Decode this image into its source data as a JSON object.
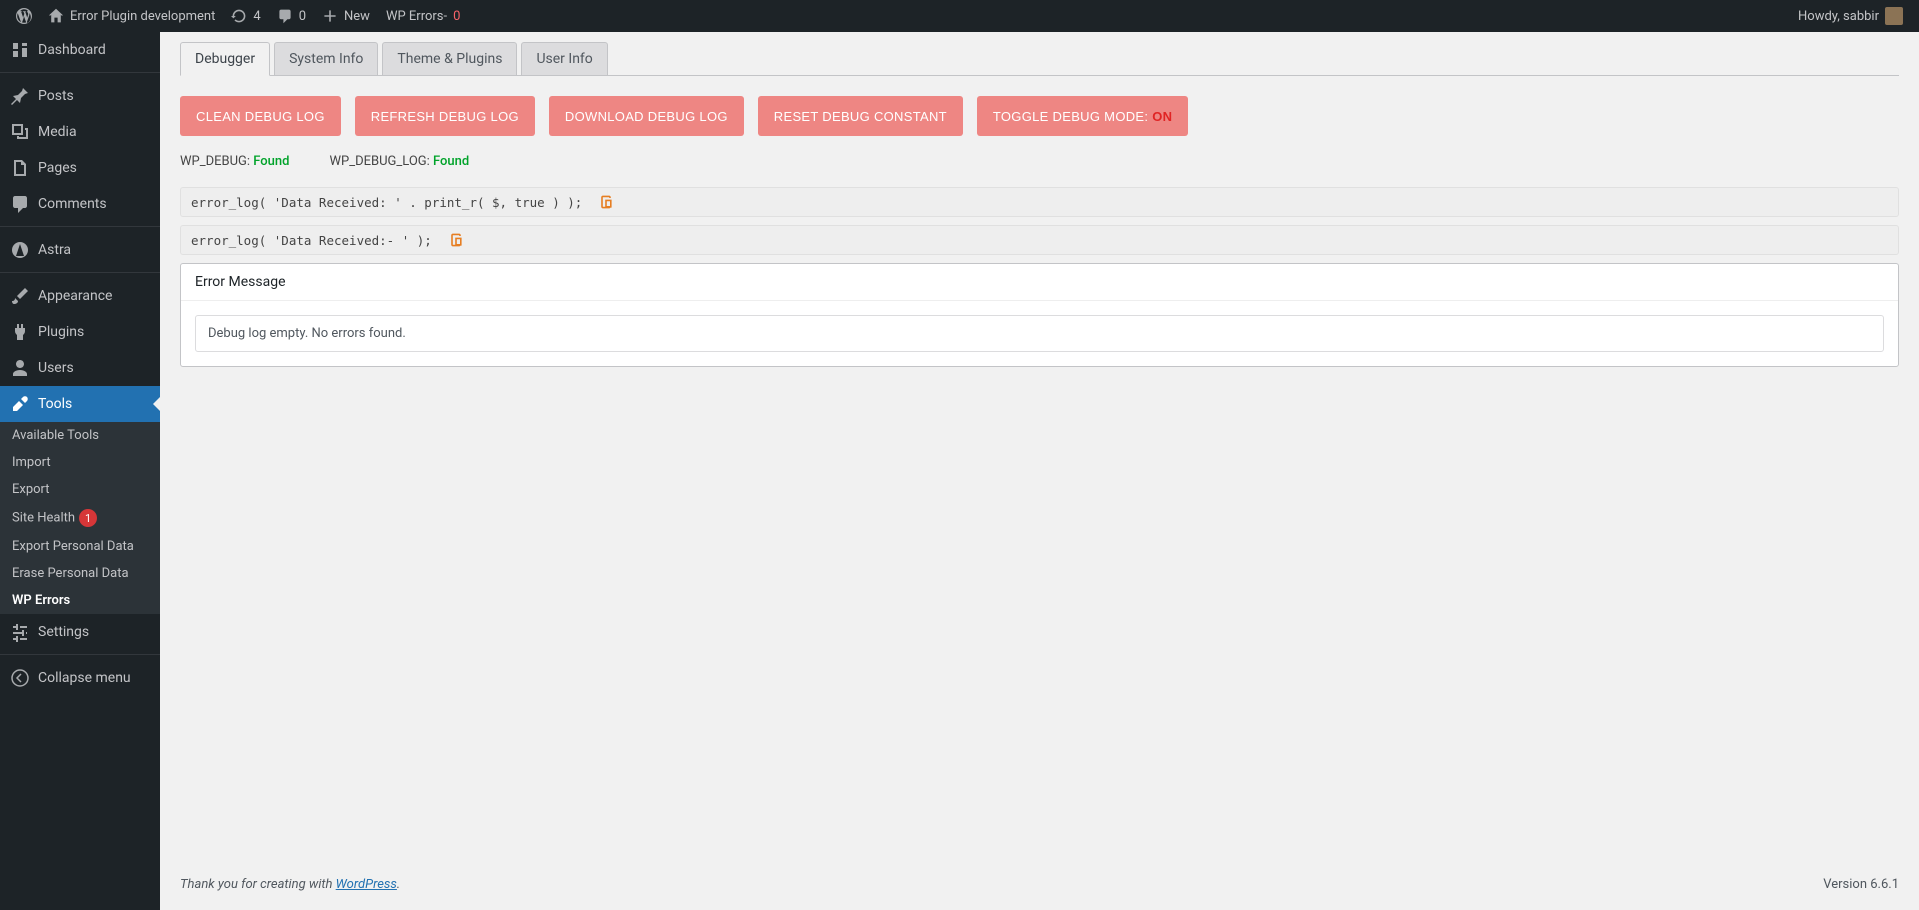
{
  "adminbar": {
    "site_name": "Error Plugin development",
    "updates_count": "4",
    "comments_count": "0",
    "new_label": "New",
    "wp_errors_label": "WP Errors-",
    "wp_errors_count": "0",
    "greeting": "Howdy, sabbir"
  },
  "sidebar": {
    "dashboard": "Dashboard",
    "posts": "Posts",
    "media": "Media",
    "pages": "Pages",
    "comments": "Comments",
    "astra": "Astra",
    "appearance": "Appearance",
    "plugins": "Plugins",
    "users": "Users",
    "tools": "Tools",
    "settings": "Settings",
    "collapse": "Collapse menu",
    "submenu": {
      "available_tools": "Available Tools",
      "import": "Import",
      "export": "Export",
      "site_health": "Site Health",
      "site_health_count": "1",
      "export_personal": "Export Personal Data",
      "erase_personal": "Erase Personal Data",
      "wp_errors": "WP Errors"
    }
  },
  "tabs": {
    "debugger": "Debugger",
    "system_info": "System Info",
    "theme_plugins": "Theme & Plugins",
    "user_info": "User Info"
  },
  "buttons": {
    "clean": "CLEAN DEBUG LOG",
    "refresh": "REFRESH DEBUG LOG",
    "download": "DOWNLOAD DEBUG LOG",
    "reset": "RESET DEBUG CONSTANT",
    "toggle_prefix": "TOGGLE DEBUG MODE: ",
    "toggle_state": "ON"
  },
  "status": {
    "wp_debug_label": "WP_DEBUG: ",
    "wp_debug_val": "Found",
    "wp_debug_log_label": "WP_DEBUG_LOG: ",
    "wp_debug_log_val": "Found"
  },
  "code": {
    "line1": "error_log( 'Data Received: ' . print_r( $, true ) );",
    "line2": "error_log( 'Data Received:-  ' );"
  },
  "panel": {
    "title": "Error Message",
    "empty": "Debug log empty. No errors found."
  },
  "footer": {
    "thanks_prefix": "Thank you for creating with ",
    "thanks_link": "WordPress",
    "thanks_suffix": ".",
    "version": "Version 6.6.1"
  }
}
